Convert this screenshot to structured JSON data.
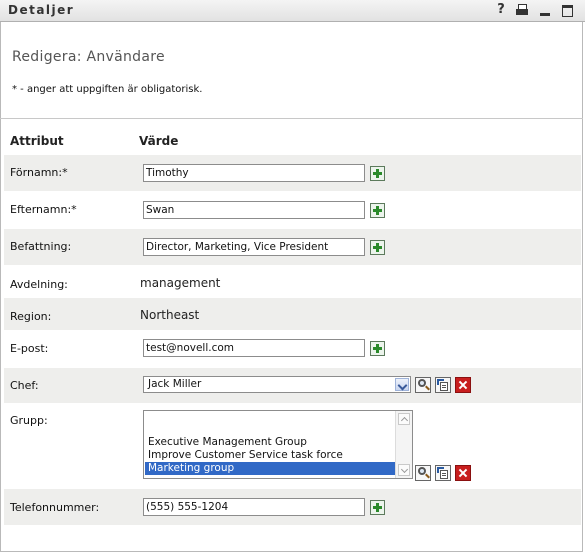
{
  "window": {
    "title": "Detaljer",
    "help_glyph": "?",
    "icons": [
      "help-icon",
      "print-icon",
      "minimize-icon",
      "maximize-icon"
    ]
  },
  "form": {
    "title": "Redigera: Användare",
    "required_note": "* - anger att uppgiften är obligatorisk.",
    "columns": {
      "attribute": "Attribut",
      "value": "Värde"
    },
    "fields": {
      "fornamn": {
        "label": "Förnamn:*",
        "value": "Timothy"
      },
      "efternamn": {
        "label": "Efternamn:*",
        "value": "Swan"
      },
      "befattning": {
        "label": "Befattning:",
        "value": "Director, Marketing, Vice President"
      },
      "avdelning": {
        "label": "Avdelning:",
        "value": "management"
      },
      "region": {
        "label": "Region:",
        "value": "Northeast"
      },
      "epost": {
        "label": "E-post:",
        "value": "test@novell.com"
      },
      "chef": {
        "label": "Chef:",
        "value": "Jack Miller"
      },
      "grupp": {
        "label": "Grupp:",
        "options": [
          "Executive Management Group",
          "Improve Customer Service task force",
          "Marketing group"
        ],
        "selected": "Marketing group"
      },
      "telefon": {
        "label": "Telefonnummer:",
        "value": "(555) 555-1204"
      }
    }
  },
  "colors": {
    "row_shade": "#eeeeec",
    "selection": "#3169c6",
    "add_green": "#2a8a2a",
    "clear_red": "#c81e1e"
  }
}
